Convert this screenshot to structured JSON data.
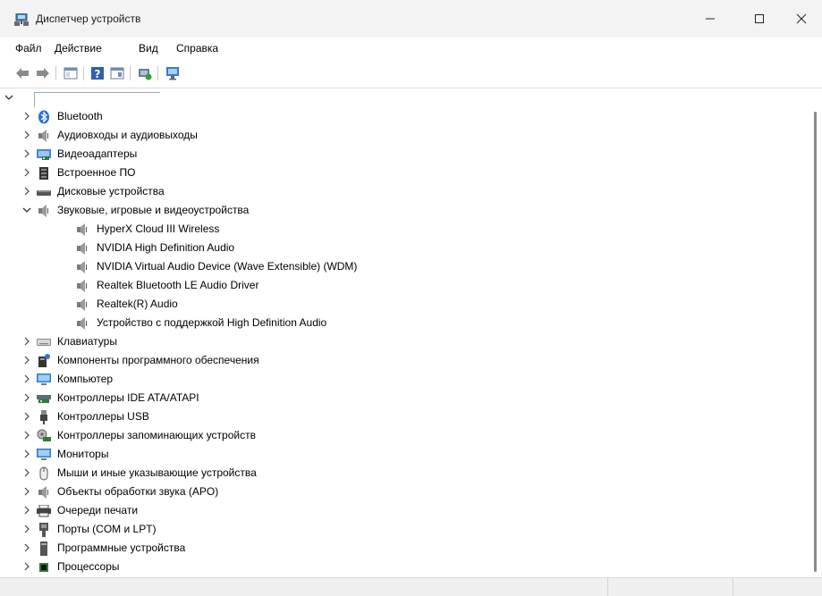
{
  "window": {
    "title": "Диспетчер устройств",
    "controls": [
      "minimize-icon",
      "maximize-icon",
      "close-icon"
    ]
  },
  "menu": [
    {
      "label": "Файл"
    },
    {
      "label": "Действие"
    },
    {
      "label": "Вид"
    },
    {
      "label": "Справка"
    }
  ],
  "toolbar": [
    "back-icon",
    "forward-icon",
    "properties-icon",
    "help-icon",
    "view-icon",
    "scan-hardware-icon",
    "monitor-icon"
  ],
  "tree": {
    "root_label": "",
    "categories": [
      {
        "label": "Bluetooth",
        "icon": "bluetooth-icon",
        "expanded": false
      },
      {
        "label": "Аудиовходы и аудиовыходы",
        "icon": "speaker-icon",
        "expanded": false
      },
      {
        "label": "Видеоадаптеры",
        "icon": "display-adapter-icon",
        "expanded": false
      },
      {
        "label": "Встроенное ПО",
        "icon": "firmware-icon",
        "expanded": false
      },
      {
        "label": "Дисковые устройства",
        "icon": "disk-icon",
        "expanded": false
      },
      {
        "label": "Звуковые, игровые и видеоустройства",
        "icon": "speaker-icon",
        "expanded": true,
        "children": [
          {
            "label": "HyperX Cloud III Wireless"
          },
          {
            "label": "NVIDIA High Definition Audio"
          },
          {
            "label": "NVIDIA Virtual Audio Device (Wave Extensible) (WDM)"
          },
          {
            "label": "Realtek Bluetooth LE Audio Driver"
          },
          {
            "label": "Realtek(R) Audio"
          },
          {
            "label": "Устройство с поддержкой High Definition Audio"
          }
        ]
      },
      {
        "label": "Клавиатуры",
        "icon": "keyboard-icon",
        "expanded": false
      },
      {
        "label": "Компоненты программного обеспечения",
        "icon": "software-component-icon",
        "expanded": false
      },
      {
        "label": "Компьютер",
        "icon": "computer-icon",
        "expanded": false
      },
      {
        "label": "Контроллеры IDE ATA/ATAPI",
        "icon": "ide-controller-icon",
        "expanded": false
      },
      {
        "label": "Контроллеры USB",
        "icon": "usb-icon",
        "expanded": false
      },
      {
        "label": "Контроллеры запоминающих устройств",
        "icon": "storage-controller-icon",
        "expanded": false
      },
      {
        "label": "Мониторы",
        "icon": "monitor-icon",
        "expanded": false
      },
      {
        "label": "Мыши и иные указывающие устройства",
        "icon": "mouse-icon",
        "expanded": false
      },
      {
        "label": "Объекты обработки звука (APO)",
        "icon": "speaker-icon",
        "expanded": false
      },
      {
        "label": "Очереди печати",
        "icon": "printer-icon",
        "expanded": false
      },
      {
        "label": "Порты (COM и LPT)",
        "icon": "port-icon",
        "expanded": false
      },
      {
        "label": "Программные устройства",
        "icon": "software-device-icon",
        "expanded": false
      },
      {
        "label": "Процессоры",
        "icon": "processor-icon",
        "expanded": false
      }
    ]
  }
}
